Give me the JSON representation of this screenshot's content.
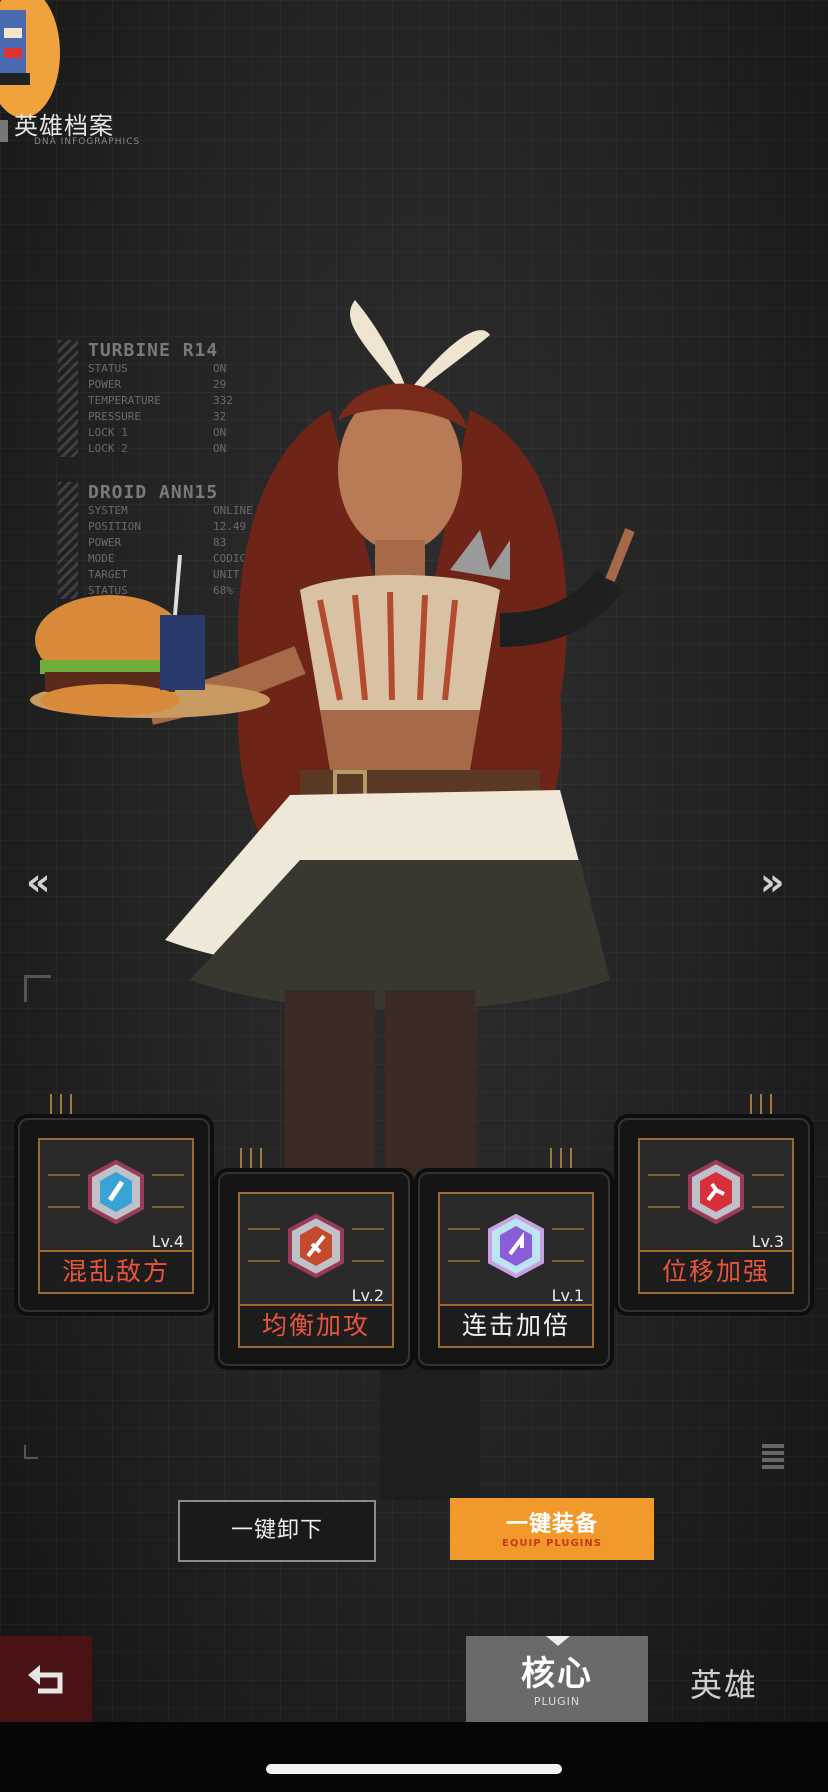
{
  "header": {
    "title": "英雄档案",
    "subtitle": "DNA INFOGRAPHICS"
  },
  "hud": {
    "block1": {
      "heading": "TURBINE R14",
      "rows": [
        {
          "k": "STATUS",
          "v": "ON"
        },
        {
          "k": "POWER",
          "v": "29"
        },
        {
          "k": "TEMPERATURE",
          "v": "332"
        },
        {
          "k": "PRESSURE",
          "v": "32"
        },
        {
          "k": "LOCK 1",
          "v": "ON"
        },
        {
          "k": "LOCK 2",
          "v": "ON"
        }
      ]
    },
    "block2": {
      "heading": "DROID ANN15",
      "rows": [
        {
          "k": "SYSTEM",
          "v": "ONLINE"
        },
        {
          "k": "POSITION",
          "v": "12.49"
        },
        {
          "k": "POWER",
          "v": "83"
        },
        {
          "k": "MODE",
          "v": "CODIC"
        },
        {
          "k": "TARGET",
          "v": "UNIT L8"
        },
        {
          "k": "STATUS",
          "v": "68%"
        }
      ]
    }
  },
  "nav_arrows": {
    "left": "«",
    "right": "»"
  },
  "plugins": [
    {
      "label": "混乱敌方",
      "level": "Lv.4",
      "label_color": "#e8553f",
      "badge_color": "#3aa3d6"
    },
    {
      "label": "均衡加攻",
      "level": "Lv.2",
      "label_color": "#e8553f",
      "badge_color": "#c44a2e"
    },
    {
      "label": "连击加倍",
      "level": "Lv.1",
      "label_color": "#f2f2f2",
      "badge_color": "#8a5cd6"
    },
    {
      "label": "位移加强",
      "level": "Lv.3",
      "label_color": "#e8553f",
      "badge_color": "#d8303a"
    }
  ],
  "buttons": {
    "unequip": "一键卸下",
    "equip": "一键装备",
    "equip_sub": "EQUIP PLUGINS"
  },
  "tabs": {
    "core": "核心",
    "core_sub": "PLUGIN",
    "hero": "英雄"
  },
  "colors": {
    "accent_orange": "#f2992b",
    "frame_gold": "#a4682c",
    "back_red": "#4a1414"
  }
}
